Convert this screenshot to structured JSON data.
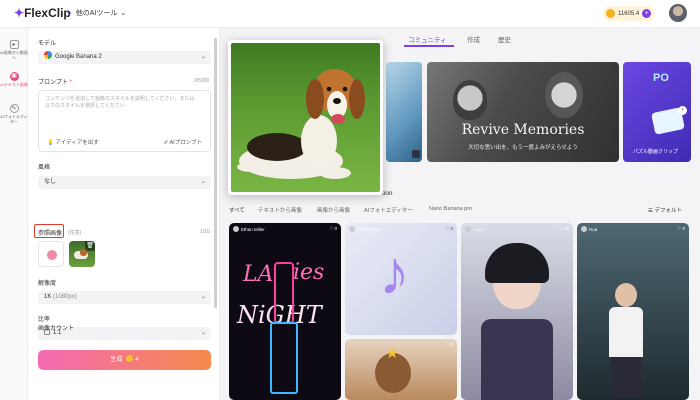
{
  "topbar": {
    "logo": "FlexClip",
    "tool_select": "他のAIツール",
    "credits": "11605.4"
  },
  "leftnav": {
    "items": [
      {
        "label": "AI画像から動画へ"
      },
      {
        "label": "AIテキスト画像"
      },
      {
        "label": "AIフォトエディター"
      }
    ]
  },
  "panel": {
    "model_label": "モデル",
    "model_value": "Google Banana 2",
    "prompt_label": "プロンプト",
    "prompt_required": "*",
    "prompt_count": "0/5000",
    "prompt_placeholder": "コンテンツを追加して画像のスタイルを説明してください。または以下のスタイルを選択してください",
    "idea_button": "アイディアを出す",
    "ai_prompt_button": "AIプロンプト",
    "style_label": "風格",
    "style_value": "なし",
    "ref_label": "参照画像",
    "ref_sub": "(任意)",
    "ref_count": "1/10",
    "resolution_label": "解像度",
    "resolution_value": "1K",
    "resolution_hint": "(1080px)",
    "ratio_label": "比率",
    "ratio_value": "1:1",
    "image_count_label": "画像カウント",
    "generate_label": "生成",
    "generate_cost": "4"
  },
  "main": {
    "tabs": [
      {
        "label": "コミュニティ"
      },
      {
        "label": "作成"
      },
      {
        "label": "歴史"
      }
    ],
    "banner_title": "Revive Memories",
    "banner_subtitle": "大切な思い出を、もう一度よみがえらせよう",
    "banner3_label": "PO",
    "banner3_text": "パズル動画クリップ",
    "section_header_fragment": "tion",
    "filters": [
      {
        "label": "すべて"
      },
      {
        "label": "テキストから画像"
      },
      {
        "label": "画像から画像"
      },
      {
        "label": "AIフォトエディター"
      },
      {
        "label": "Nano Banana pro"
      }
    ],
    "default_sort": "デフォルト",
    "cards": [
      {
        "author": "Ethan Miller",
        "likes": "0",
        "art_line1": "LA",
        "art_line2": "ies",
        "art_line3": "NiGHT"
      },
      {
        "author": "Ethan Miller",
        "likes": "0"
      },
      {
        "author": "Joyce",
        "likes": "1k"
      },
      {
        "author": "Hua",
        "likes": "0"
      },
      {
        "author": "...",
        "likes": "0"
      }
    ]
  },
  "colors": {
    "accent": "#7b3fe4",
    "pink": "#e34c7a",
    "highlight_red": "#e23b2b",
    "generate_start": "#f36ab5",
    "generate_end": "#f58a4b"
  }
}
